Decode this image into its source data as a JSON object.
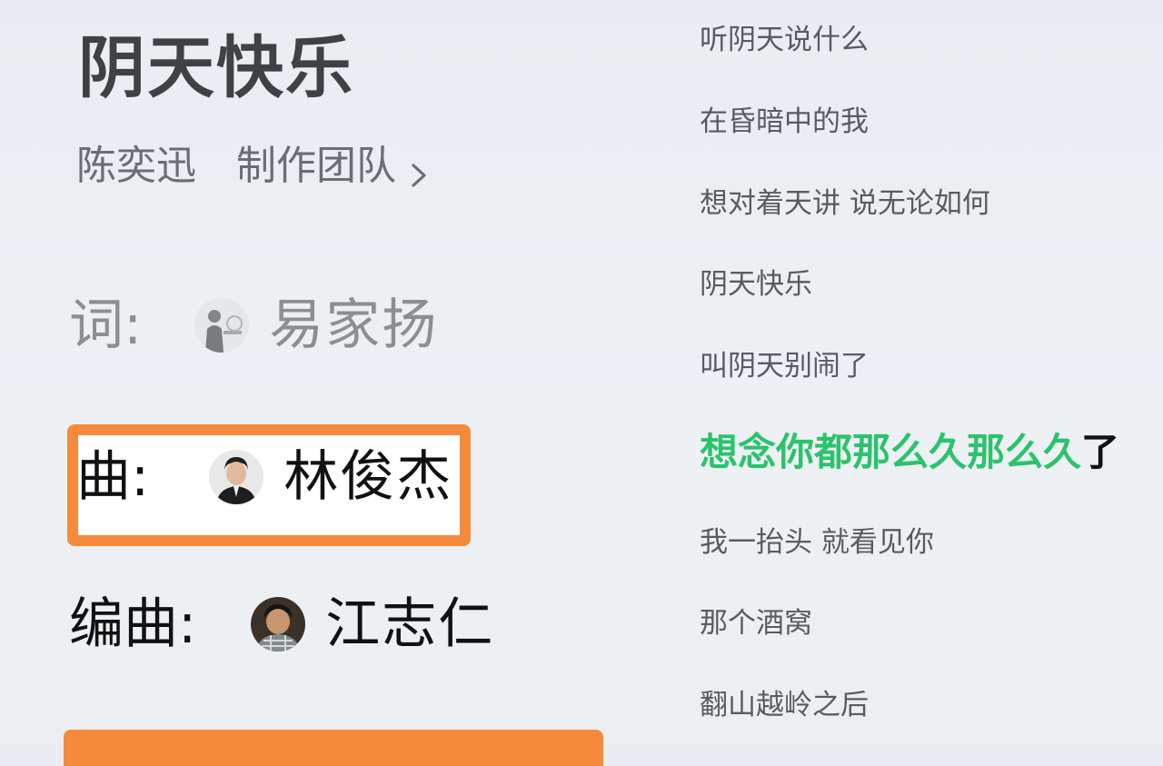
{
  "song": {
    "title": "阴天快乐",
    "artist": "陈奕迅",
    "team_link": "制作团队"
  },
  "credits": {
    "lyricist": {
      "label": "词:",
      "name": "易家扬"
    },
    "composer": {
      "label": "曲:",
      "name": "林俊杰"
    },
    "arranger": {
      "label": "编曲:",
      "name": "江志仁"
    }
  },
  "lyrics": {
    "lines": [
      "听阴天说什么",
      "在昏暗中的我",
      "想对着天讲 说无论如何",
      "阴天快乐",
      "叫阴天别闹了",
      "想念你都那么久那么久了",
      "我一抬头 就看见你",
      "那个酒窝",
      "翻山越岭之后"
    ],
    "current_index": 5,
    "current_sung": "想念你都那么久那么久",
    "current_unsung": "了"
  },
  "colors": {
    "highlight": "#f68a3c",
    "current_lyric": "#2bc36c"
  },
  "icons": {
    "team_link": "chevron-right-icon"
  }
}
